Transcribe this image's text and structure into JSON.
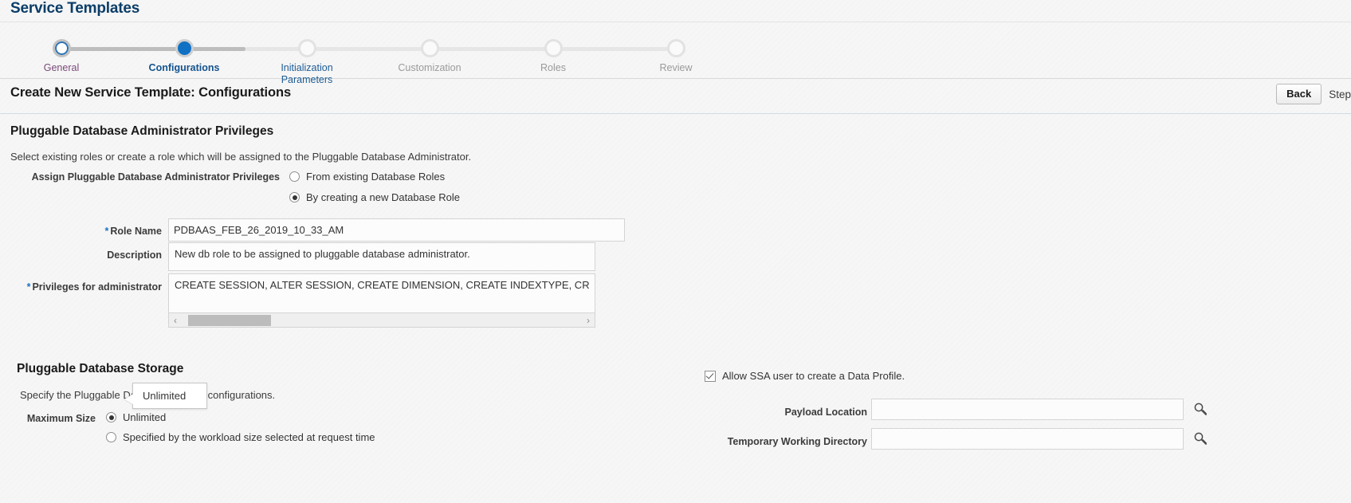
{
  "page": {
    "title": "Service Templates"
  },
  "train": {
    "steps": [
      {
        "label": "General",
        "state": "done"
      },
      {
        "label": "Configurations",
        "state": "current"
      },
      {
        "label": "Initialization\nParameters",
        "state": "next"
      },
      {
        "label": "Customization",
        "state": "future"
      },
      {
        "label": "Roles",
        "state": "future"
      },
      {
        "label": "Review",
        "state": "future"
      }
    ]
  },
  "subheader": {
    "title": "Create New Service Template: Configurations",
    "back_label": "Back",
    "step_label": "Step"
  },
  "admin_privileges": {
    "section_title": "Pluggable Database Administrator Privileges",
    "section_desc": "Select existing roles or create a role which will be assigned to the Pluggable Database Administrator.",
    "assign_label": "Assign Pluggable Database Administrator Privileges",
    "option_existing": "From existing Database Roles",
    "option_new": "By creating a new Database Role",
    "selected_option": "By creating a new Database Role",
    "role_name_label": "Role Name",
    "role_name_value": "PDBAAS_FEB_26_2019_10_33_AM",
    "description_label": "Description",
    "description_value": "New db role to be assigned to pluggable database administrator.",
    "privileges_label": "Privileges for administrator",
    "privileges_value": "CREATE SESSION, ALTER SESSION, CREATE DIMENSION, CREATE INDEXTYPE, CR"
  },
  "storage": {
    "section_title": "Pluggable Database Storage",
    "section_desc": "Specify the Pluggable Database storage configurations.",
    "max_size_label": "Maximum Size",
    "option_unlimited": "Unlimited",
    "option_workload": "Specified by the workload size selected at request time",
    "selected_option": "Unlimited",
    "tooltip_text": "Unlimited"
  },
  "data_profile": {
    "checkbox_label": "Allow SSA user to create a Data Profile.",
    "checkbox_checked": true,
    "payload_location_label": "Payload Location",
    "payload_location_value": "",
    "temp_dir_label": "Temporary Working Directory",
    "temp_dir_value": "",
    "search_icon_name": "flashlight-search-icon"
  },
  "colors": {
    "title_blue": "#0b3d68",
    "current_step_blue": "#1071c4",
    "required_star_blue": "#1f72c0"
  }
}
